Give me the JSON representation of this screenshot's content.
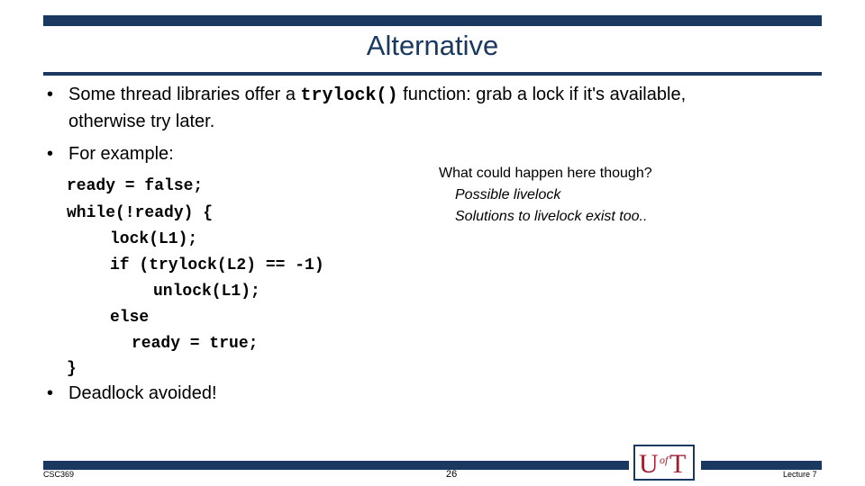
{
  "slide": {
    "title": "Alternative",
    "bullets": {
      "b1_pre": "Some thread libraries offer a ",
      "b1_code": "trylock()",
      "b1_post": " function: grab a lock if it's available,",
      "b1_line2": "otherwise try later.",
      "b2": "For example:",
      "b3": "Deadlock avoided!"
    },
    "code_lines": [
      "ready = false;",
      "while(!ready) {",
      "lock(L1);",
      "if (trylock(L2) == -1)",
      "unlock(L1);",
      "else",
      "ready = true;",
      "}"
    ],
    "note": {
      "question": "What could happen here though?",
      "line1": "Possible livelock",
      "line2": "Solutions to livelock exist too.."
    }
  },
  "footer": {
    "course": "CSC369",
    "page": "26",
    "lecture": "Lecture 7"
  },
  "logo": {
    "text": "UofT"
  },
  "colors": {
    "brand": "#1b3860",
    "logo_red": "#a01c2e"
  }
}
